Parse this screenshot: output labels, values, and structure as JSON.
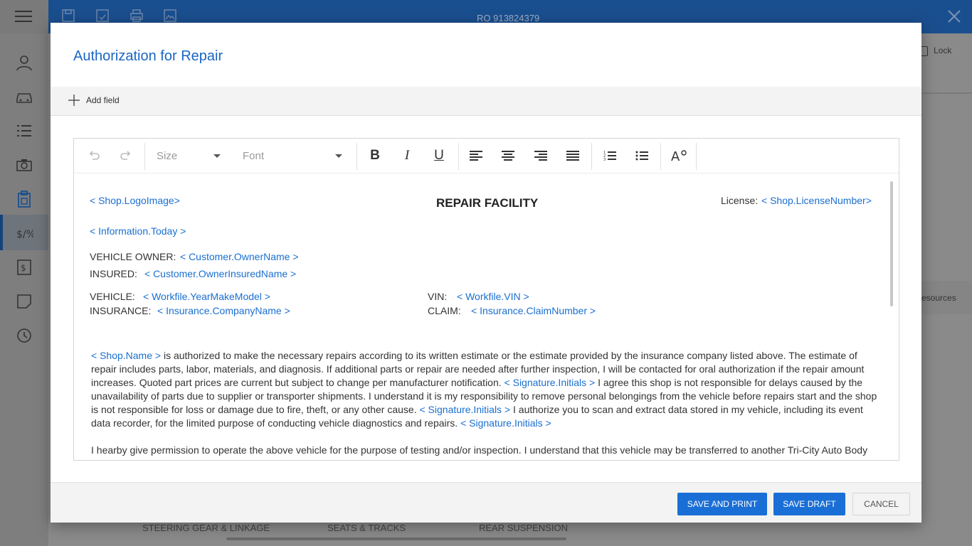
{
  "app": {
    "ro_number": "RO 913824379",
    "lock_label": "Lock",
    "resources_label": "esources",
    "bottom_items": [
      "STEERING GEAR & LINKAGE",
      "SEATS & TRACKS",
      "REAR SUSPENSION"
    ]
  },
  "modal": {
    "title": "Authorization for Repair",
    "add_field_label": "Add field"
  },
  "toolbar": {
    "size_placeholder": "Size",
    "font_placeholder": "Font"
  },
  "doc": {
    "logo": "< Shop.LogoImage>",
    "heading": "REPAIR FACILITY",
    "license_label": "License:",
    "license_value": "< Shop.LicenseNumber>",
    "today": "< Information.Today >",
    "owner_label": "VEHICLE OWNER:",
    "owner_value": "< Customer.OwnerName >",
    "insured_label": "INSURED:",
    "insured_value": "< Customer.OwnerInsuredName >",
    "vehicle_label": "VEHICLE:",
    "vehicle_value": "< Workfile.YearMakeModel >",
    "vin_label": "VIN:",
    "vin_value": "< Workfile.VIN >",
    "insurance_label": "INSURANCE:",
    "insurance_value": "< Insurance.CompanyName >",
    "claim_label": "CLAIM:",
    "claim_value": "< Insurance.ClaimNumber >",
    "p1_shop": "< Shop.Name >",
    "p1_text1": " is authorized to make the necessary repairs according to its written estimate or the estimate provided by the insurance company listed above. The estimate of repair includes parts, labor, materials, and diagnosis. If additional parts or repair are needed after further inspection, I will be contacted for oral authorization if the repair amount increases. Quoted part prices are current but subject to change per manufacturer notification. ",
    "p1_sig1": "< Signature.Initials >",
    "p1_text2": "   I agree this shop is not responsible for delays caused by the unavailability of parts due to supplier or transporter shipments. I understand it is my responsibility to remove personal belongings from the vehicle before repairs start and the shop is not responsible for loss or damage due to fire, theft, or any other cause. ",
    "p1_sig2": "< Signature.Initials >",
    "p1_text3": "   I authorize you to scan and extract data stored in my vehicle, including its event data recorder, for the limited purpose of conducting vehicle diagnostics and repairs. ",
    "p1_sig3": "< Signature.Initials >",
    "p2_text": "I hearby give permission to operate the above vehicle for the purpose of testing and/or inspection. I understand that this vehicle may be transferred to another Tri-City Auto Body location."
  },
  "footer": {
    "save_print": "SAVE AND PRINT",
    "save_draft": "SAVE DRAFT",
    "cancel": "CANCEL"
  },
  "colors": {
    "app_header": "#1a4f8f",
    "accent": "#1a6fd6",
    "placeholder_text": "#1a6fd0"
  }
}
